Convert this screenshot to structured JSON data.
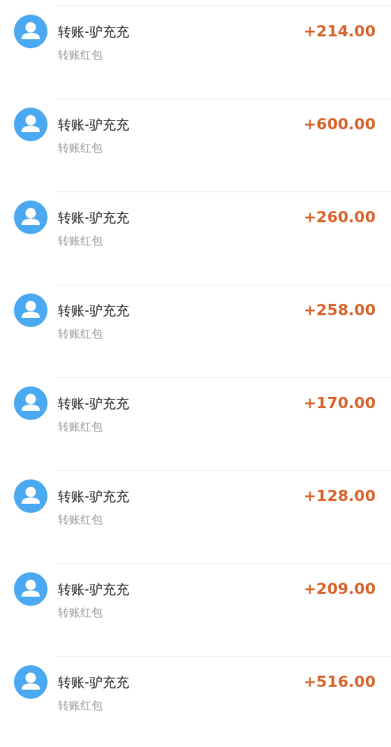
{
  "transactions": [
    {
      "title": "转账-驴充充",
      "subtitle": "转账红包",
      "amount": "+214.00"
    },
    {
      "title": "转账-驴充充",
      "subtitle": "转账红包",
      "amount": "+600.00"
    },
    {
      "title": "转账-驴充充",
      "subtitle": "转账红包",
      "amount": "+260.00"
    },
    {
      "title": "转账-驴充充",
      "subtitle": "转账红包",
      "amount": "+258.00"
    },
    {
      "title": "转账-驴充充",
      "subtitle": "转账红包",
      "amount": "+170.00"
    },
    {
      "title": "转账-驴充充",
      "subtitle": "转账红包",
      "amount": "+128.00"
    },
    {
      "title": "转账-驴充充",
      "subtitle": "转账红包",
      "amount": "+209.00"
    },
    {
      "title": "转账-驴充充",
      "subtitle": "转账红包",
      "amount": "+516.00"
    }
  ]
}
